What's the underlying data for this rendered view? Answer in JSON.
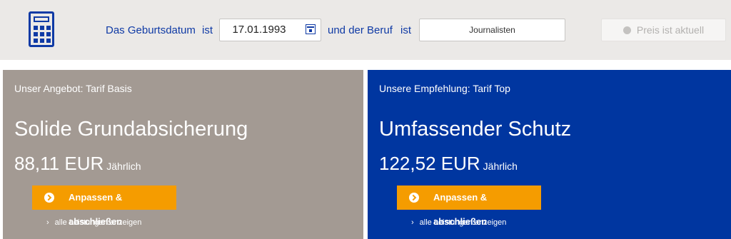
{
  "header": {
    "label_birthdate": "Das Geburtsdatum",
    "label_ist1": "ist",
    "birthdate_value": "17.01.1993",
    "label_job": "und der Beruf",
    "label_ist2": "ist",
    "job_value": "Journalisten",
    "price_button": "Preis ist aktuell"
  },
  "offers": [
    {
      "eyebrow": "Unser Angebot: Tarif Basis",
      "headline": "Solide Grundabsicherung",
      "amount": "88,11 EUR",
      "period": "Jährlich",
      "cta": "Anpassen & abschließen",
      "more": "alle Leistungen anzeigen",
      "color": "#a39a93"
    },
    {
      "eyebrow": "Unsere Empfehlung: Tarif Top",
      "headline": "Umfassender Schutz",
      "amount": "122,52 EUR",
      "period": "Jährlich",
      "cta": "Anpassen & abschließen",
      "more": "alle Leistungen anzeigen",
      "color": "#0036a0"
    }
  ],
  "colors": {
    "brand_blue": "#0f3aa5",
    "accent_orange": "#f59c00",
    "topbar_bg": "#ebe9e7"
  }
}
